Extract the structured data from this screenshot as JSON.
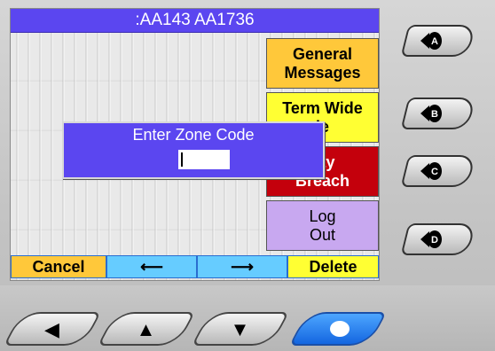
{
  "window": {
    "title": ":AA143  AA1736"
  },
  "menu": {
    "items": [
      {
        "label": "General\nMessages",
        "color": "#ffc83a"
      },
      {
        "label": "Term Wide\nle",
        "color": "#ffff33"
      },
      {
        "label": "rity\nBreach",
        "color": "#c4000c"
      },
      {
        "label": "Log\nOut",
        "color": "#c8a8f0"
      }
    ]
  },
  "soft_keys": {
    "cancel": "Cancel",
    "left_arrow": "⟵",
    "right_arrow": "⟶",
    "delete": "Delete"
  },
  "dialog": {
    "title": "Enter Zone Code",
    "input_value": ""
  },
  "side_keys": [
    {
      "name": "A",
      "icon": "circle-A-icon"
    },
    {
      "name": "B",
      "icon": "circle-B-icon"
    },
    {
      "name": "C",
      "icon": "circle-C-icon"
    },
    {
      "name": "D",
      "icon": "circle-D-icon"
    }
  ],
  "nav_keys": [
    {
      "icon": "left-triangle-icon",
      "glyph": "◀"
    },
    {
      "icon": "up-triangle-icon",
      "glyph": "▲"
    },
    {
      "icon": "down-triangle-icon",
      "glyph": "▼"
    },
    {
      "icon": "select-dot-icon",
      "glyph": ""
    }
  ],
  "colors": {
    "title_bar": "#5b46f0",
    "dialog": "#5b46f0",
    "accent_blue": "#1466e0"
  }
}
